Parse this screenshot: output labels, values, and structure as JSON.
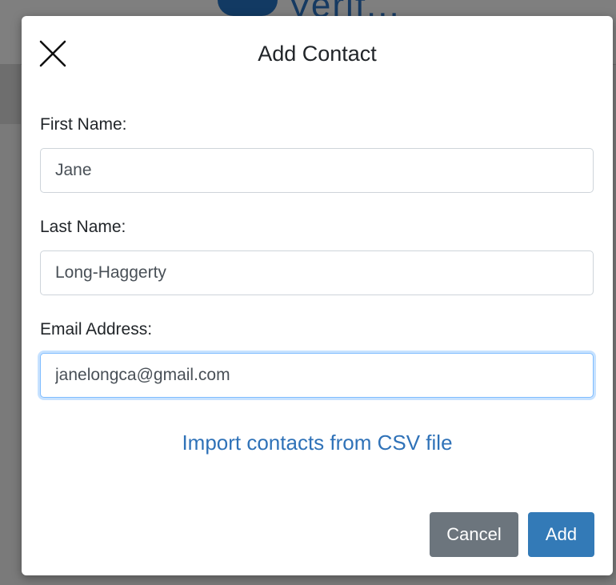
{
  "backdrop": {
    "logo_text": "Verif..."
  },
  "modal": {
    "title": "Add Contact",
    "close_icon": "close-icon"
  },
  "form": {
    "first_name": {
      "label": "First Name:",
      "value": "Jane"
    },
    "last_name": {
      "label": "Last Name:",
      "value": "Long-Haggerty"
    },
    "email": {
      "label": "Email Address:",
      "value": "janelongca@gmail.com"
    }
  },
  "import_link": "Import contacts from CSV file",
  "buttons": {
    "cancel": "Cancel",
    "add": "Add"
  },
  "colors": {
    "primary": "#337ab7",
    "secondary": "#6c757d",
    "link": "#2f72b8",
    "focus_border": "#80bdff"
  }
}
